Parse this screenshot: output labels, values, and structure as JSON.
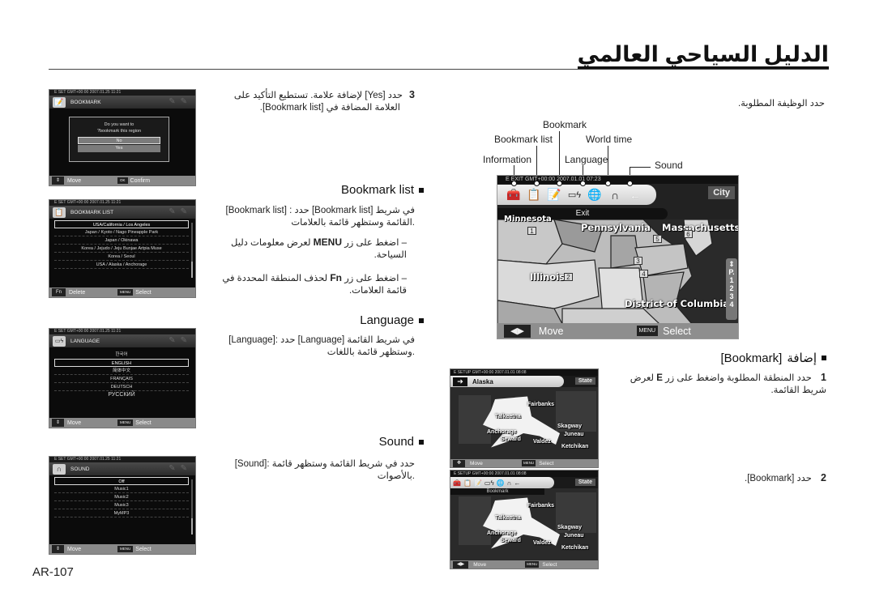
{
  "page": {
    "title": "الدليل السياحي العالمي",
    "page_number": "AR-107"
  },
  "right_column": {
    "intro": "حدد الوظيفة المطلوبة.",
    "callouts": {
      "information": "Information",
      "bookmark_list": "Bookmark list",
      "bookmark": "Bookmark",
      "language": "Language",
      "world_time": "World time",
      "sound": "Sound"
    },
    "main_screen": {
      "status": "E EXIT        GMT+00:00 2007.01.01 07:23",
      "icons": [
        "info-icon",
        "bookmark-list-icon",
        "bookmark-add-icon",
        "language-icon",
        "world-time-icon",
        "sound-icon",
        "back-arrow-icon"
      ],
      "city_label": "City",
      "exit_label": "Exit",
      "regions": [
        {
          "name": "Minnesota",
          "num": "1"
        },
        {
          "name": "Pennsylvania",
          "num": ""
        },
        {
          "name": "Massachusetts",
          "num": ""
        },
        {
          "name": "Illinois",
          "num": "2"
        },
        {
          "name": "District of Columbia",
          "num": ""
        }
      ],
      "markers": [
        "1",
        "2",
        "3",
        "4",
        "5",
        "6"
      ],
      "pager": {
        "prefix": "P.",
        "pages": [
          "1",
          "2",
          "3",
          "4"
        ]
      },
      "footer": {
        "move_key": "◀▶",
        "move_label": "Move",
        "select_key": "MENU",
        "select_label": "Select"
      }
    },
    "add_bookmark": {
      "heading_bracket": "[Bookmark]",
      "heading_ar": "إضافة",
      "step1_num": "1",
      "step1_text_a": "حدد المنطقة المطلوبة واضغط على زر",
      "step1_key": "E",
      "step1_text_b": "لعرض شريط القائمة.",
      "step2_num": "2",
      "step2_text": "حدد [Bookmark]."
    },
    "alaska_screen_1": {
      "status": "E SETUP       GMT+00:00 2007.01.01 08:08",
      "title": "Alaska",
      "state_label": "State",
      "places": [
        "Fairbanks",
        "Talkeetna",
        "Anchorage",
        "Seward",
        "Valdez",
        "Skagway",
        "Juneau",
        "Ketchikan"
      ],
      "footer": {
        "move_label": "Move",
        "select_key": "MENU",
        "select_label": "Select"
      }
    },
    "alaska_screen_2": {
      "status": "E SETUP       GMT+00:00 2007.01.01 08:08",
      "sub_label": "Bookmark",
      "state_label": "State",
      "places": [
        "Fairbanks",
        "Talkeetna",
        "Anchorage",
        "Seward",
        "Valdez",
        "Skagway",
        "Juneau",
        "Ketchikan"
      ],
      "footer": {
        "move_label": "Move",
        "select_key": "MENU",
        "select_label": "Select"
      }
    }
  },
  "left_column": {
    "step3": {
      "num": "3",
      "line1": "حدد [Yes] لإضافة علامة. تستطيع التأكيد على",
      "line2": "العلامة المضافة في [Bookmark list]."
    },
    "bookmark_dialog_screen": {
      "status": "E SET        GMT+00:00 2007.01.25 11:21",
      "title": "BOOKMARK",
      "question_line1": "Do you want to",
      "question_line2": "?bookmark this region",
      "options": [
        "No",
        "Yes"
      ],
      "footer": {
        "move_label": "Move",
        "confirm_key": "OK",
        "confirm_label": "Confirm"
      }
    },
    "bookmark_list_section": {
      "heading": "Bookmark list",
      "desc": "[Bookmark list] : حدد [Bookmark list] في شريط القائمة وستظهر قائمة بالعلامات.",
      "bullet1_a": "اضغط على زر",
      "bullet1_key": "MENU",
      "bullet1_b": "لعرض معلومات دليل السياحة.",
      "bullet2_a": "اضغط على زر",
      "bullet2_key": "Fn",
      "bullet2_b": "لحذف المنطقة المحددة في قائمة العلامات."
    },
    "bookmark_list_screen": {
      "status": "E SET        GMT+00:00 2007.01.25 11:21",
      "title": "BOOKMARK LIST",
      "items": [
        "USA/California / Los Angeles",
        "Japan / Kyoto / Nago Pineapple Park",
        "Japan / Okinawa",
        "Korea / Jejudo / Jeju Bunjae Artpia Muse",
        "Korea / Seoul",
        "USA / Alaska / Anchorage"
      ],
      "selected_index": 0,
      "footer": {
        "fn_key": "Fn",
        "fn_label": "Delete",
        "select_key": "MENU",
        "select_label": "Select"
      }
    },
    "language_section": {
      "heading": "Language",
      "desc": "[Language]:  حدد [Language] في شريط القائمة وستظهر قائمة باللغات."
    },
    "language_screen": {
      "status": "E SET        GMT+00:00 2007.01.25 11:21",
      "title": "LANGUAGE",
      "items": [
        "한국어",
        "ENGLISH",
        "简体中文",
        "FRANÇAIS",
        "DEUTSCH",
        "РУССКИЙ"
      ],
      "selected_index": 1,
      "footer": {
        "move_label": "Move",
        "select_key": "MENU",
        "select_label": "Select"
      }
    },
    "sound_section": {
      "heading": "Sound",
      "desc": "[Sound]: حدد في شريط القائمة وستظهر قائمة بالأصوات."
    },
    "sound_screen": {
      "status": "E SET        GMT+00:00 2007.01.25 11:21",
      "title": "SOUND",
      "items": [
        "Off",
        "Music1",
        "Music2",
        "Music3",
        "MyMP3"
      ],
      "selected_index": 0,
      "footer": {
        "move_label": "Move",
        "select_key": "MENU",
        "select_label": "Select"
      }
    }
  }
}
